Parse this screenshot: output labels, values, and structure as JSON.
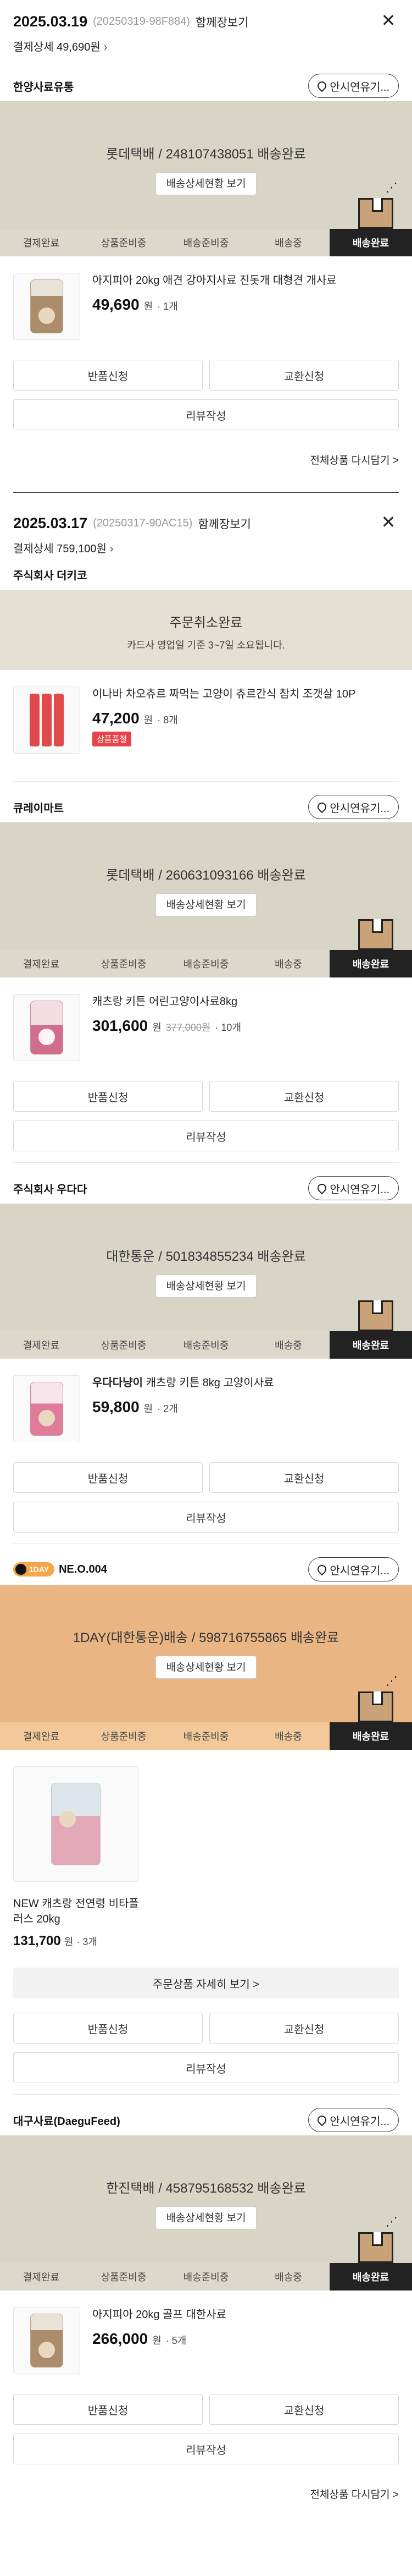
{
  "orders": [
    {
      "date": "2025.03.19",
      "order_no": "(20250319-98F884)",
      "cart_link": "함께장보기",
      "payment_detail": "결제상세 49,690원",
      "close_icon": "close-icon",
      "shipments": [
        {
          "seller": "한양사료유통",
          "notice_button": "안시연유기...",
          "banner_title": "롯데택배 / 248107438051 배송완료",
          "track_button": "배송상세현황 보기",
          "steps": [
            "결제완료",
            "상품준비중",
            "배송준비중",
            "배송중",
            "배송완료"
          ],
          "active_step": "배송완료",
          "product_name": "아지피아 20kg 애견 강아지사료 진돗개 대형견 개사료",
          "price": "49,690",
          "unit": "원",
          "qty": "· 1개",
          "buttons": [
            "반품신청",
            "교환신청",
            "리뷰작성"
          ],
          "reorder": "전체상품 다시담기 >"
        }
      ]
    },
    {
      "date": "2025.03.17",
      "order_no": "(20250317-90AC15)",
      "cart_link": "함께장보기",
      "payment_detail": "결제상세 759,100원",
      "close_icon": "close-icon",
      "shipments": [
        {
          "seller": "주식회사 더키코",
          "banner_title": "주문취소완료",
          "banner_sub": "카드사 영업일 기준 3~7일 소요됩니다.",
          "product_name": "이나바 차오츄르 짜먹는 고양이 츄르간식 참치 조갯살 10P",
          "price": "47,200",
          "unit": "원",
          "qty": "· 8개",
          "badge": "상품품절"
        },
        {
          "seller": "큐레이마트",
          "notice_button": "안시연유기...",
          "banner_title": "롯데택배 / 260631093166 배송완료",
          "track_button": "배송상세현황 보기",
          "steps": [
            "결제완료",
            "상품준비중",
            "배송준비중",
            "배송중",
            "배송완료"
          ],
          "product_name": "캐츠랑 키튼 어린고양이사료8kg",
          "price": "301,600",
          "unit": "원",
          "strike": "377,000원",
          "qty": "· 10개",
          "buttons": [
            "반품신청",
            "교환신청",
            "리뷰작성"
          ]
        },
        {
          "seller": "주식회사 우다다",
          "notice_button": "안시연유기...",
          "banner_title": "대한통운 / 501834855234 배송완료",
          "track_button": "배송상세현황 보기",
          "steps": [
            "결제완료",
            "상품준비중",
            "배송준비중",
            "배송중",
            "배송완료"
          ],
          "product_name_bold": "우다다냥이",
          "product_name": "캐츠랑 키튼 8kg 고양이사료",
          "price": "59,800",
          "unit": "원",
          "qty": "· 2개",
          "buttons": [
            "반품신청",
            "교환신청",
            "리뷰작성"
          ]
        },
        {
          "seller": "NE.O.004",
          "brand_logo": "1DAY",
          "notice_button": "안시연유기...",
          "banner_title": "1DAY(대한통운)배송 / 598716755865 배송완료",
          "track_button": "배송상세현황 보기",
          "steps": [
            "결제완료",
            "상품준비중",
            "배송준비중",
            "배송중",
            "배송완료"
          ],
          "product_name": "NEW 캐츠랑 전연령 비타플러스 20kg",
          "price": "131,700",
          "unit": "원",
          "qty": "· 3개",
          "more_items": "주문상품 자세히 보기 >",
          "buttons": [
            "반품신청",
            "교환신청",
            "리뷰작성"
          ]
        },
        {
          "seller": "대구사료(DaeguFeed)",
          "notice_button": "안시연유기...",
          "banner_title": "한진택배 / 458795168532 배송완료",
          "track_button": "배송상세현황 보기",
          "steps": [
            "결제완료",
            "상품준비중",
            "배송준비중",
            "배송중",
            "배송완료"
          ],
          "product_name": "아지피아 20kg 골프 대한사료",
          "price": "266,000",
          "unit": "원",
          "qty": "· 5개",
          "buttons": [
            "반품신청",
            "교환신청",
            "리뷰작성"
          ],
          "reorder": "전체상품 다시담기 >"
        }
      ]
    }
  ],
  "colors": {
    "banner": "#d8d5c7",
    "banner_orange": "#e9b582",
    "active_step": "#222222",
    "soldout_badge": "#e9424a"
  },
  "icons": {
    "close": "close-icon",
    "location": "location-pin-icon",
    "delivery_box": "delivery-box-icon",
    "chevron": "chevron-right-icon"
  }
}
